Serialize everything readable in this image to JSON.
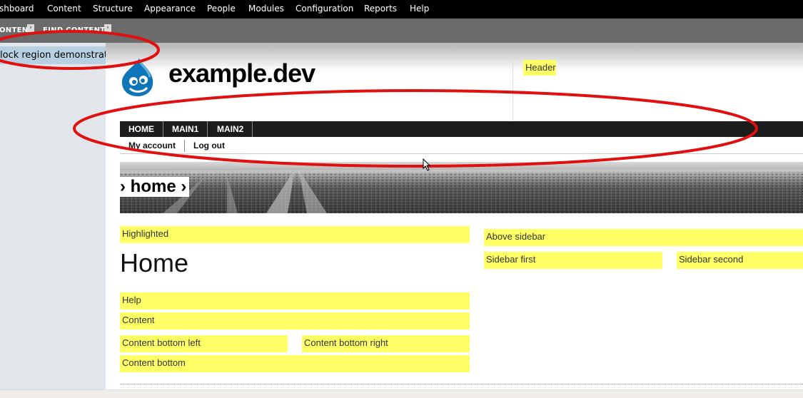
{
  "toolbar": {
    "items": [
      {
        "label": "shboard"
      },
      {
        "label": "Content"
      },
      {
        "label": "Structure"
      },
      {
        "label": "Appearance"
      },
      {
        "label": "People"
      },
      {
        "label": "Modules"
      },
      {
        "label": "Configuration"
      },
      {
        "label": "Reports"
      },
      {
        "label": "Help"
      }
    ]
  },
  "shortcuts": {
    "items": [
      {
        "label": "ONTENT"
      },
      {
        "label": "FIND CONTENT"
      }
    ],
    "arrow_icon": "right-chevron-icon"
  },
  "left_block": {
    "label": "lock region demonstration"
  },
  "site": {
    "name": "example.dev",
    "logo_icon": "drupal-drop-logo-icon"
  },
  "regions": {
    "header": "Header",
    "highlighted": "Highlighted",
    "help": "Help",
    "content": "Content",
    "content_bottom_left": "Content bottom left",
    "content_bottom_right": "Content bottom right",
    "content_bottom": "Content bottom",
    "above_sidebar": "Above sidebar",
    "sidebar_first": "Sidebar first",
    "sidebar_second": "Sidebar second"
  },
  "main_menu": {
    "items": [
      {
        "label": "HOME"
      },
      {
        "label": "MAIN1"
      },
      {
        "label": "MAIN2"
      }
    ]
  },
  "secondary_menu": {
    "items": [
      {
        "label": "My account"
      },
      {
        "label": "Log out"
      }
    ]
  },
  "breadcrumb": "› home ›",
  "page_title": "Home",
  "colors": {
    "region_highlight": "#ffff66",
    "annotation_ellipse": "#e01010",
    "toolbar_bg": "#000000",
    "menu_bg": "#1c1c1c"
  }
}
